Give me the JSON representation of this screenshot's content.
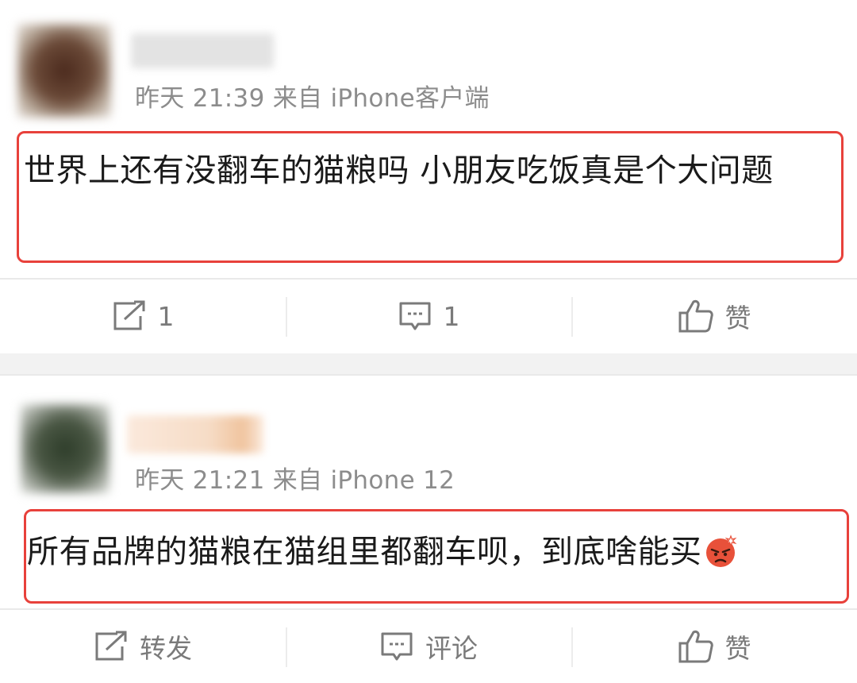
{
  "posts": [
    {
      "time": "昨天 21:39",
      "source": "来自 iPhone客户端",
      "content": "世界上还有没翻车的猫粮吗 小朋友吃饭真是个大问题",
      "avatar_color": "#5a3a2a",
      "name_blur_color": "#d9d9d9",
      "actions": {
        "repost": "1",
        "comment": "1",
        "like": "赞"
      }
    },
    {
      "time": "昨天 21:21",
      "source": "来自 iPhone 12",
      "content": "所有品牌的猫粮在猫组里都翻车呗，到底啥能买",
      "avatar_color": "#3c4a36",
      "name_blur_color": "#f3d9c4",
      "actions": {
        "repost": "转发",
        "comment": "评论",
        "like": "赞"
      }
    }
  ],
  "colors": {
    "highlight_border": "#e8413b",
    "meta_text": "#8c8c8c",
    "action_text": "#7a7a7a"
  },
  "icons": [
    "repost-icon",
    "comment-icon",
    "like-icon",
    "angry-emoji-icon"
  ]
}
